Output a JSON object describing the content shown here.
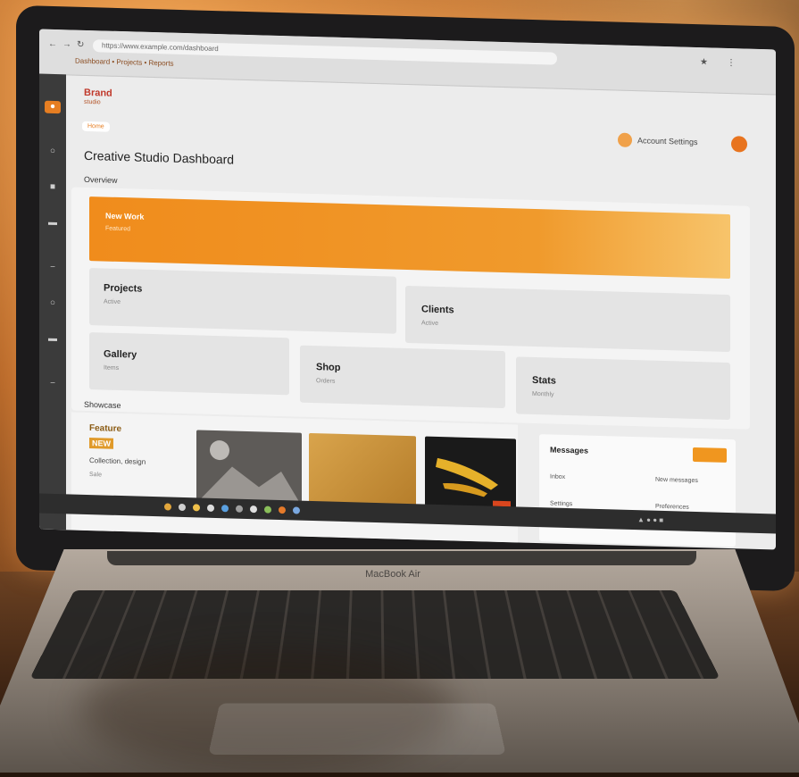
{
  "browser": {
    "address": "https://www.example.com/dashboard",
    "tabs": "Dashboard • Projects • Reports"
  },
  "brand": {
    "name": "Brand",
    "tagline": "studio"
  },
  "header": {
    "pill": "Home",
    "user_label": "Account Settings"
  },
  "page": {
    "title": "Creative Studio Dashboard",
    "section_label": "Overview",
    "section2": "Showcase"
  },
  "hero": {
    "title": "New Work",
    "subtitle": "Featured"
  },
  "cards": [
    {
      "title": "Projects",
      "sub": "Active"
    },
    {
      "title": "Clients",
      "sub": "Active"
    },
    {
      "title": "Gallery",
      "sub": "Items"
    },
    {
      "title": "Shop",
      "sub": "Orders"
    },
    {
      "title": "Stats",
      "sub": "Monthly"
    }
  ],
  "promo": {
    "title": "Feature",
    "badge": "NEW",
    "text": "Collection, design",
    "foot": "Sale"
  },
  "side_panel": {
    "title": "Messages",
    "rows": [
      {
        "left": "Inbox",
        "right": "New messages"
      },
      {
        "left": "Settings",
        "right": "Preferences"
      }
    ]
  },
  "colors": {
    "accent": "#f08c1c",
    "sidebar": "#3b3b3b",
    "brand": "#c0392b"
  },
  "keyboard_label": "MacBook Air"
}
